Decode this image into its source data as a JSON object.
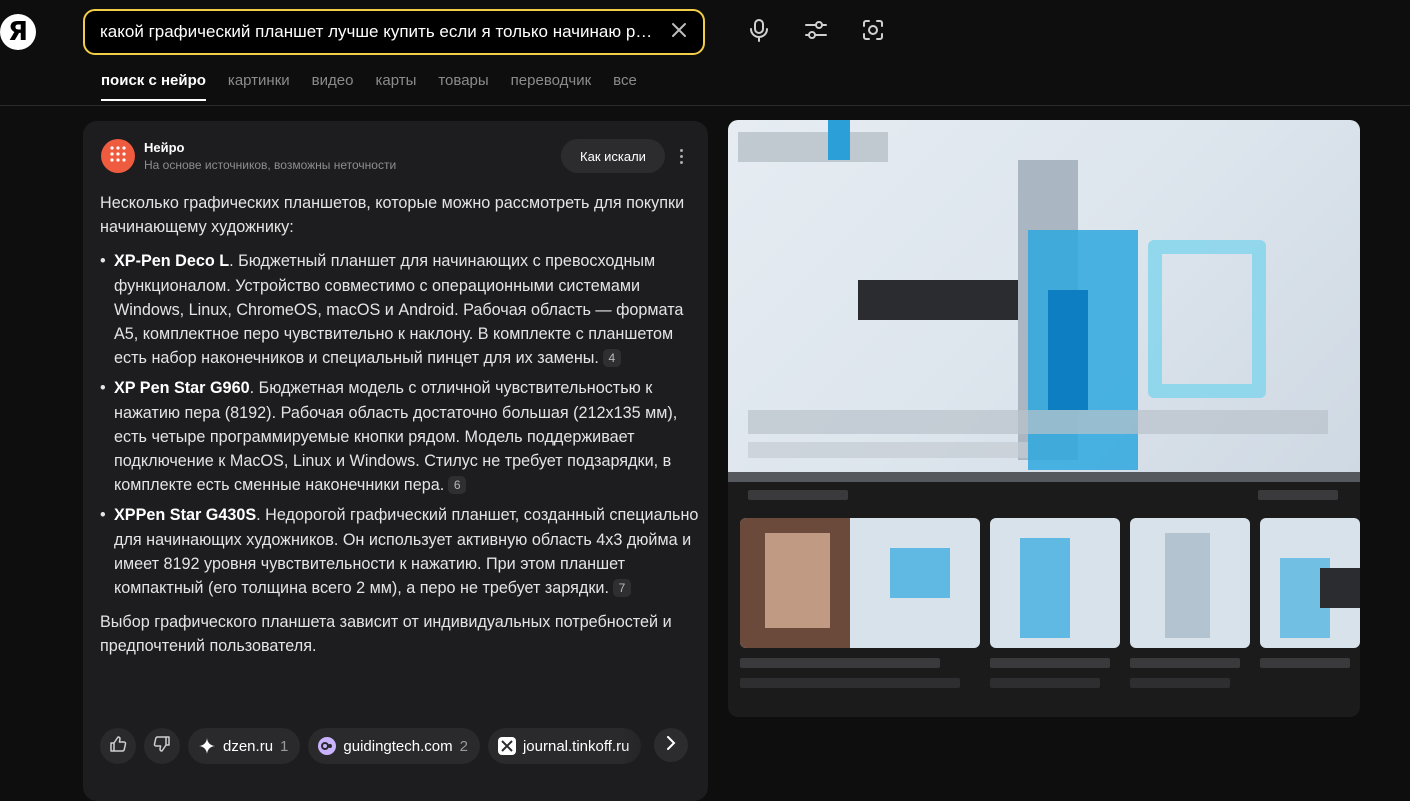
{
  "header": {
    "logo": "Я",
    "search_value": "какой графический планшет лучше купить если я только начинаю рисовать",
    "icons": [
      "close-icon",
      "microphone-icon",
      "filters-icon",
      "camera-search-icon"
    ]
  },
  "tabs": [
    {
      "label": "поиск с нейро",
      "active": true
    },
    {
      "label": "картинки"
    },
    {
      "label": "видео"
    },
    {
      "label": "карты"
    },
    {
      "label": "товары"
    },
    {
      "label": "переводчик"
    },
    {
      "label": "все"
    }
  ],
  "card": {
    "name": "Нейро",
    "subtitle": "На основе источников, возможны неточности",
    "how_button": "Как искали",
    "intro": "Несколько графических планшетов, которые можно рассмотреть для покупки начинающему художнику:",
    "items": [
      {
        "title": "XP-Pen Deco L",
        "text": ". Бюджетный планшет для начинающих с превосходным функционалом. Устройство совместимо с операционными системами Windows, Linux, ChromeOS, macOS и Android. Рабочая область — формата А5, комплектное перо чувствительно к наклону. В комплекте с планшетом есть набор наконечников и специальный пинцет для их замены.",
        "cite": "4"
      },
      {
        "title": "XP Pen Star G960",
        "text": ". Бюджетная модель с отличной чувствительностью к нажатию пера (8192). Рабочая область достаточно большая (212х135 мм), есть четыре программируемые кнопки рядом. Модель поддерживает подключение к MacOS, Linux и Windows. Стилус не требует подзарядки, в комплекте есть сменные наконечники пера.",
        "cite": "6"
      },
      {
        "title": "XPPen Star G430S",
        "text": ". Недорогой графический планшет, созданный специально для начинающих художников. Он использует активную область 4х3 дюйма и имеет 8192 уровня чувствительности к нажатию. При этом планшет компактный (его толщина всего 2 мм), а перо не требует зарядки.",
        "cite": "7"
      }
    ],
    "conclusion": "Выбор графического планшета зависит от индивидуальных потребностей и предпочтений пользователя.",
    "sources": [
      {
        "name": "dzen.ru",
        "count": "1",
        "color": "#ffffff"
      },
      {
        "name": "guidingtech.com",
        "count": "2",
        "color": "#c9b3ff"
      },
      {
        "name": "journal.tinkoff.ru",
        "count": "",
        "color": "#ffffff"
      }
    ]
  },
  "colors": {
    "accent": "#f2cd47",
    "neuro": "#ef5b3e",
    "background": "#0e0e0f",
    "card": "#1d1d1f"
  }
}
